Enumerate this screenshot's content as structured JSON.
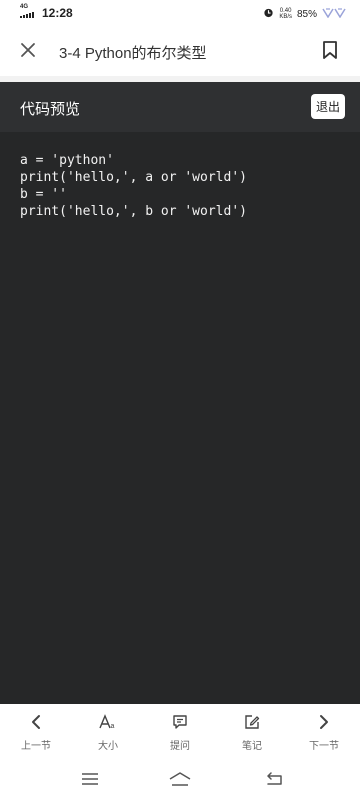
{
  "status_bar": {
    "network": "4G",
    "time": "12:28",
    "speed_value": "0.40",
    "speed_unit": "KB/s",
    "battery": "85%"
  },
  "header": {
    "title": "3-4 Python的布尔类型"
  },
  "code_panel": {
    "title": "代码预览",
    "exit_label": "退出",
    "lines": [
      "a = 'python'",
      "print('hello,', a or 'world')",
      "b = ''",
      "print('hello,', b or 'world')"
    ]
  },
  "bottom_nav": {
    "items": [
      {
        "label": "上一节",
        "icon": "chevron-left-icon"
      },
      {
        "label": "大小",
        "icon": "font-size-icon"
      },
      {
        "label": "提问",
        "icon": "question-chat-icon"
      },
      {
        "label": "笔记",
        "icon": "edit-note-icon"
      },
      {
        "label": "下一节",
        "icon": "chevron-right-icon"
      }
    ]
  },
  "colors": {
    "panel_bg": "#262728",
    "panel_header_bg": "#2f3032",
    "code_text": "#f2f2f2"
  }
}
